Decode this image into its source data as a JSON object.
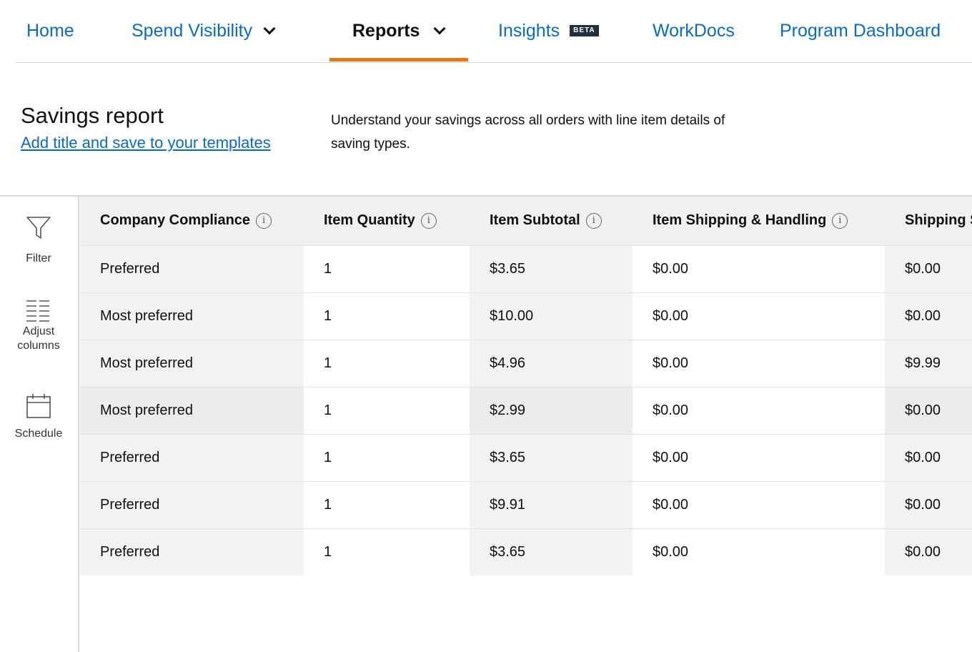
{
  "nav": {
    "items": [
      {
        "label": "Home"
      },
      {
        "label": "Spend Visibility"
      },
      {
        "label": "Reports"
      },
      {
        "label": "Insights",
        "badge": "BETA"
      },
      {
        "label": "WorkDocs"
      },
      {
        "label": "Program Dashboard"
      }
    ],
    "active": "Reports"
  },
  "header": {
    "title": "Savings report",
    "save_link": "Add title and save to your templates",
    "description": "Understand your savings across all orders with line item details of saving types."
  },
  "tools": [
    {
      "label": "Filter",
      "icon": "funnel-icon"
    },
    {
      "label": "Adjust columns",
      "icon": "columns-icon"
    },
    {
      "label": "Schedule",
      "icon": "calendar-icon"
    }
  ],
  "table": {
    "columns": [
      "Company Compliance",
      "Item Quantity",
      "Item Subtotal",
      "Item Shipping & Handling",
      "Shipping Savings"
    ],
    "rows": [
      [
        "Preferred",
        "1",
        "$3.65",
        "$0.00",
        "$0.00"
      ],
      [
        "Most preferred",
        "1",
        "$10.00",
        "$0.00",
        "$0.00"
      ],
      [
        "Most preferred",
        "1",
        "$4.96",
        "$0.00",
        "$9.99"
      ],
      [
        "Most preferred",
        "1",
        "$2.99",
        "$0.00",
        "$0.00"
      ],
      [
        "Preferred",
        "1",
        "$3.65",
        "$0.00",
        "$0.00"
      ],
      [
        "Preferred",
        "1",
        "$9.91",
        "$0.00",
        "$0.00"
      ],
      [
        "Preferred",
        "1",
        "$3.65",
        "$0.00",
        "$0.00"
      ]
    ]
  },
  "colors": {
    "link": "#0b6ac4",
    "active_tab_underline": "#e47911",
    "header_bg": "#f0f0f0",
    "shaded_column": "#f2f2f2"
  }
}
